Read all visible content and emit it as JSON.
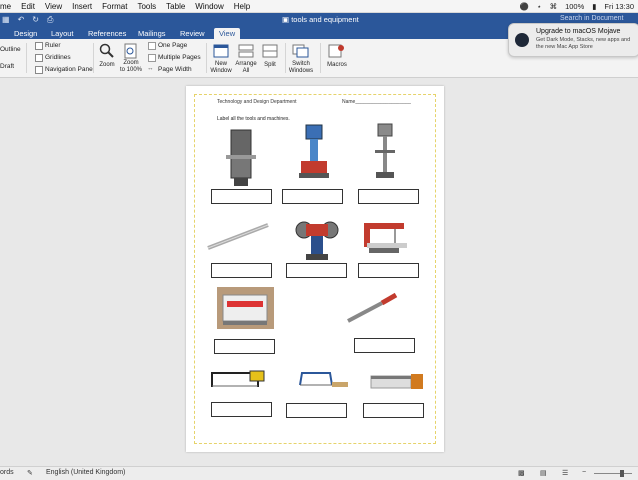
{
  "menubar": {
    "items": [
      "me",
      "Edit",
      "View",
      "Insert",
      "Format",
      "Tools",
      "Table",
      "Window",
      "Help"
    ],
    "battery": "100%",
    "clock": "Fri 13:30"
  },
  "document": {
    "title": "tools and equipment"
  },
  "search": {
    "placeholder": "Search in Document"
  },
  "tabs": {
    "design": "Design",
    "layout": "Layout",
    "references": "References",
    "mailings": "Mailings",
    "review": "Review",
    "view": "View"
  },
  "ribbon": {
    "outline": "Outline",
    "draft": "Draft",
    "ruler": "Ruler",
    "gridlines": "Gridlines",
    "navigation_pane": "Navigation Pane",
    "zoom": "Zoom",
    "zoom100_line1": "Zoom",
    "zoom100_line2": "to 100%",
    "one_page": "One Page",
    "multiple_pages": "Multiple Pages",
    "page_width": "Page Width",
    "new_window_line1": "New",
    "new_window_line2": "Window",
    "arrange_all_line1": "Arrange",
    "arrange_all_line2": "All",
    "split": "Split",
    "switch_windows_line1": "Switch",
    "switch_windows_line2": "Windows",
    "macros": "Macros"
  },
  "notification": {
    "title": "Upgrade to macOS Mojave",
    "body": "Get Dark Mode, Stacks, new apps and the new Mac App Store"
  },
  "page": {
    "department": "Technology and Design Department",
    "name_label": "Name____________________",
    "instruction": "Label all the tools and machines."
  },
  "statusbar": {
    "words": "ords",
    "language": "English (United Kingdom)"
  },
  "colors": {
    "word_blue": "#2b579a",
    "page_margin": "#e6d36a"
  }
}
